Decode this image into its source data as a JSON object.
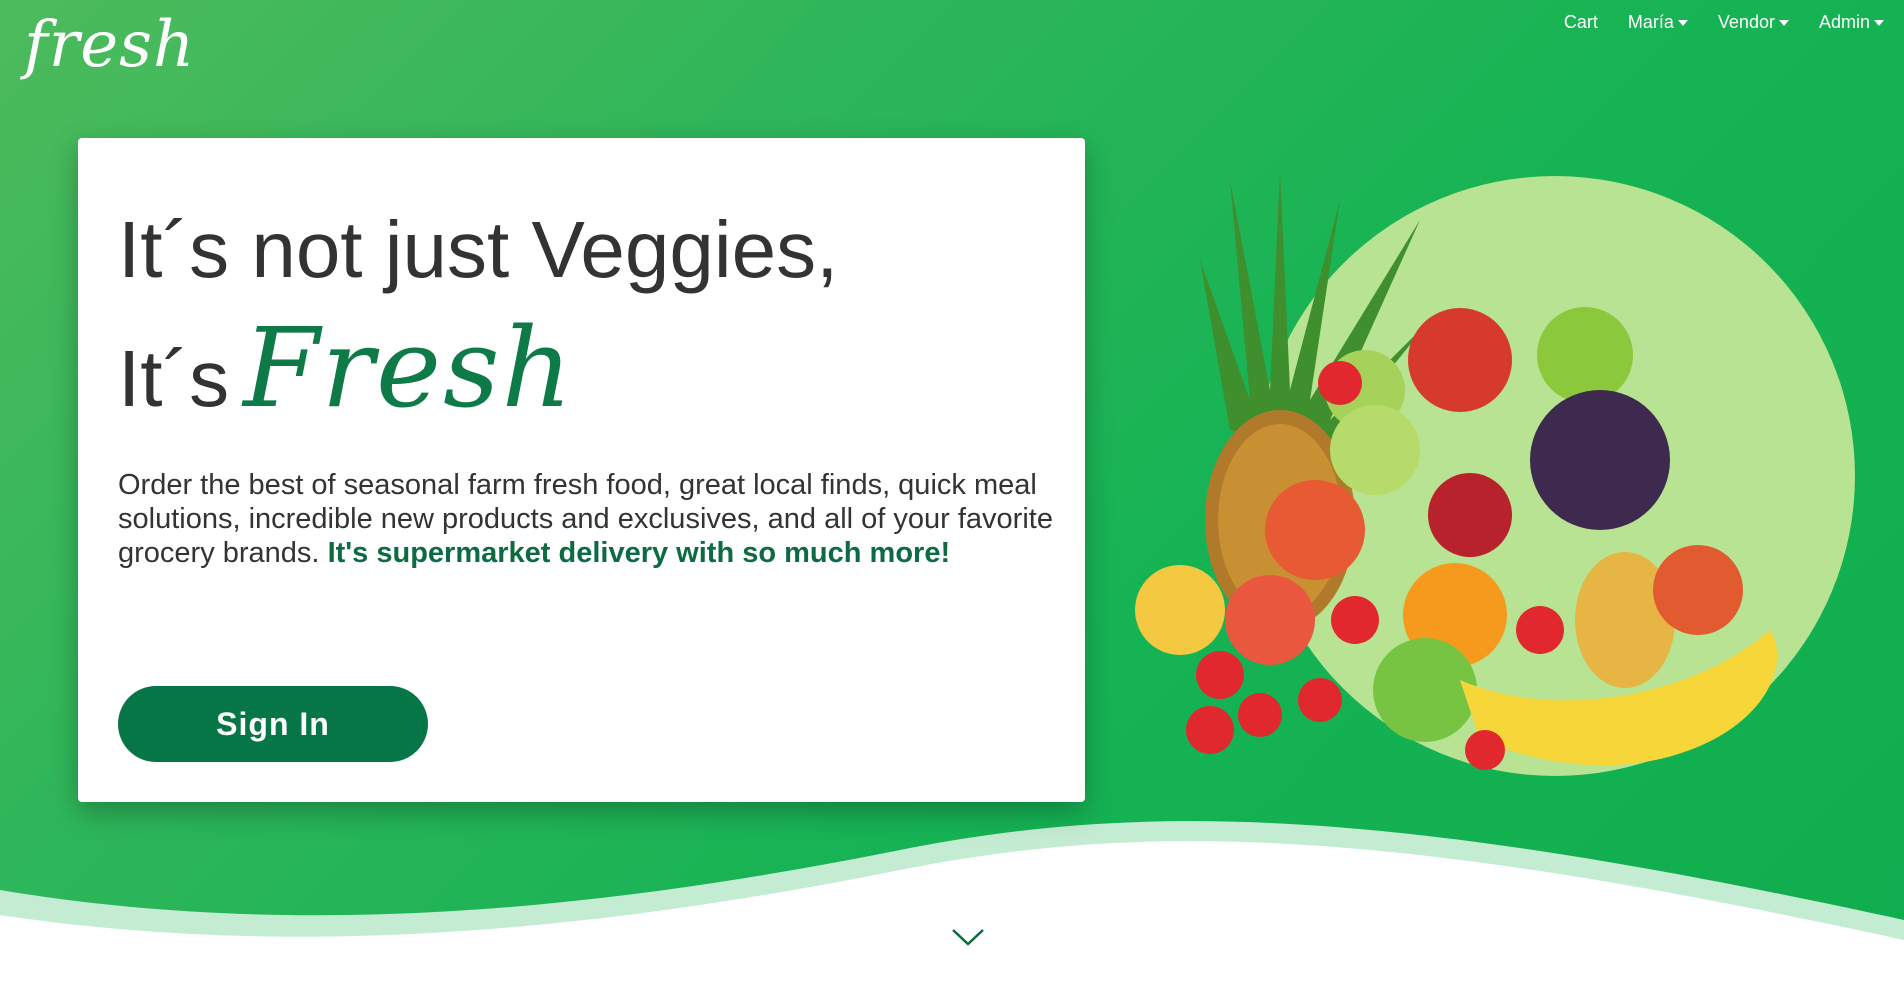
{
  "brand": {
    "logo_text": "fresh"
  },
  "nav": {
    "items": [
      {
        "label": "Cart",
        "dropdown": false
      },
      {
        "label": "María",
        "dropdown": true
      },
      {
        "label": "Vendor",
        "dropdown": true
      },
      {
        "label": "Admin",
        "dropdown": true
      }
    ]
  },
  "hero": {
    "headline_line1": "It´s not just Veggies,",
    "headline_line2_prefix": "It´s",
    "headline_line2_script": "Fresh",
    "description": "Order the best of seasonal farm fresh food, great local finds, quick meal solutions, incredible new products and exclusives, and all of your favorite grocery brands.",
    "description_highlight": "It's supermarket delivery with so much more!",
    "signin_label": "Sign In"
  },
  "icons": {
    "scroll_down": "chevron-down-icon",
    "nav_caret": "caret-down-icon"
  },
  "colors": {
    "brand_green": "#077646",
    "accent_text": "#0d6b41",
    "hero_bg": "#16b354",
    "circle": "#b7e392"
  }
}
